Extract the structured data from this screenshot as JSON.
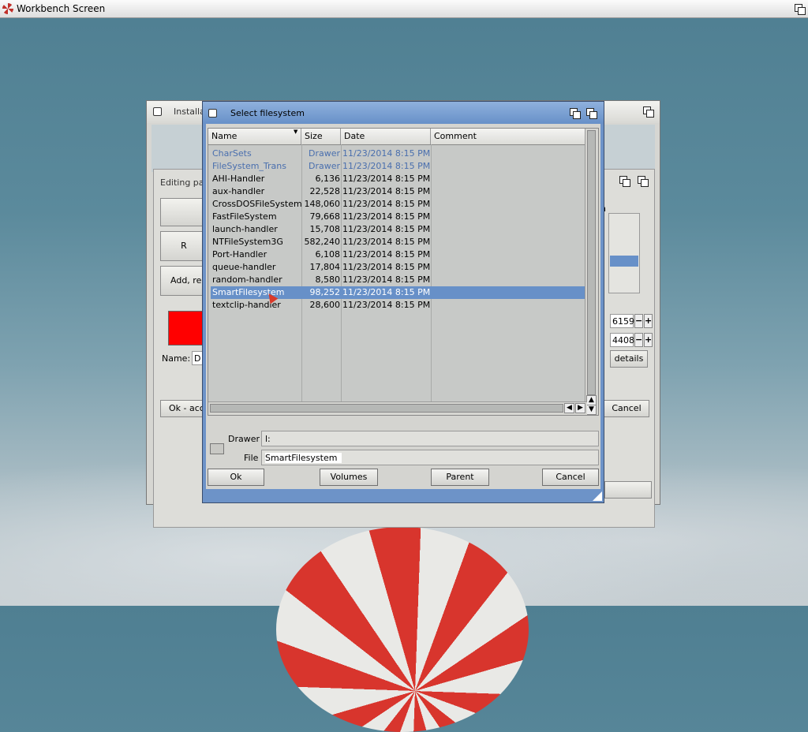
{
  "screen": {
    "title": "Workbench Screen"
  },
  "background_window": {
    "title": "Installa",
    "edit_title": "Editing pa",
    "buttons": [
      "R",
      "Add, rer"
    ],
    "name_label": "Name:",
    "name_value": "D",
    "right_values": [
      "6159",
      "4408"
    ],
    "details_label": "details",
    "ok_label": "Ok - acc",
    "cancel_label": "Cancel",
    "side_label": "h"
  },
  "dialog": {
    "title": "Select filesystem",
    "columns": [
      "Name",
      "Size",
      "Date",
      "Comment"
    ],
    "files": [
      {
        "name": "CharSets",
        "size": "Drawer",
        "date": "11/23/2014 8:15 PM",
        "type": "drawer"
      },
      {
        "name": "FileSystem_Trans",
        "size": "Drawer",
        "date": "11/23/2014 8:15 PM",
        "type": "drawer"
      },
      {
        "name": "AHI-Handler",
        "size": "6,136",
        "date": "11/23/2014 8:15 PM",
        "type": "file"
      },
      {
        "name": "aux-handler",
        "size": "22,528",
        "date": "11/23/2014 8:15 PM",
        "type": "file"
      },
      {
        "name": "CrossDOSFileSystem",
        "size": "148,060",
        "date": "11/23/2014 8:15 PM",
        "type": "file"
      },
      {
        "name": "FastFileSystem",
        "size": "79,668",
        "date": "11/23/2014 8:15 PM",
        "type": "file"
      },
      {
        "name": "launch-handler",
        "size": "15,708",
        "date": "11/23/2014 8:15 PM",
        "type": "file"
      },
      {
        "name": "NTFileSystem3G",
        "size": "582,240",
        "date": "11/23/2014 8:15 PM",
        "type": "file"
      },
      {
        "name": "Port-Handler",
        "size": "6,108",
        "date": "11/23/2014 8:15 PM",
        "type": "file"
      },
      {
        "name": "queue-handler",
        "size": "17,804",
        "date": "11/23/2014 8:15 PM",
        "type": "file"
      },
      {
        "name": "random-handler",
        "size": "8,580",
        "date": "11/23/2014 8:15 PM",
        "type": "file"
      },
      {
        "name": "SmartFilesystem",
        "size": "98,252",
        "date": "11/23/2014 8:15 PM",
        "type": "file",
        "selected": true
      },
      {
        "name": "textclip-handler",
        "size": "28,600",
        "date": "11/23/2014 8:15 PM",
        "type": "file"
      }
    ],
    "drawer_label": "Drawer",
    "drawer_value": "l:",
    "file_label": "File",
    "file_value": "SmartFilesystem",
    "buttons": {
      "ok": "Ok",
      "volumes": "Volumes",
      "parent": "Parent",
      "cancel": "Cancel"
    }
  }
}
